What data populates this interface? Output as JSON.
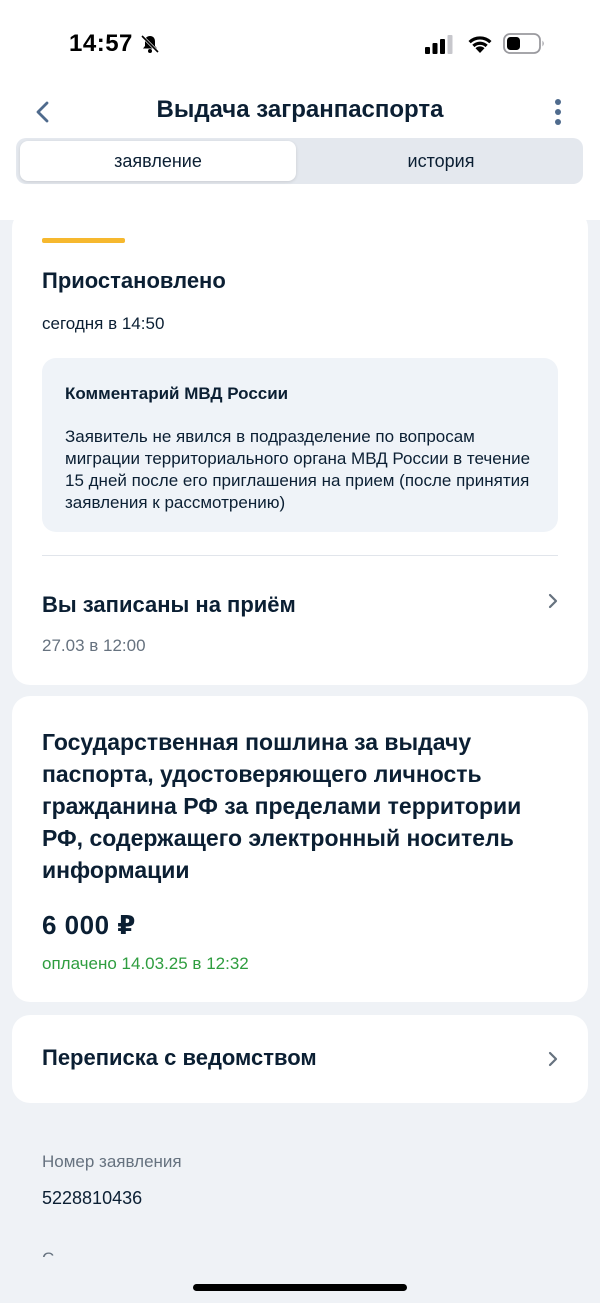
{
  "status_bar": {
    "time": "14:57",
    "icons": [
      "bell-slash-icon",
      "signal-icon",
      "wifi-icon",
      "battery-icon"
    ]
  },
  "header": {
    "title": "Выдача загранпаспорта",
    "back_icon": "chevron-left-icon",
    "menu_icon": "more-vertical-icon"
  },
  "tabs": [
    {
      "label": "заявление",
      "active": true
    },
    {
      "label": "история",
      "active": false
    }
  ],
  "status_card": {
    "accent_color": "#f6b82e",
    "status": "Приостановлено",
    "time": "сегодня в 14:50",
    "comment": {
      "title": "Комментарий МВД России",
      "text": "Заявитель не явился в подразделение по вопросам миграции территориального органа МВД России в течение 15 дней после его приглашения на прием (после принятия заявления к рассмотрению)"
    },
    "appointment": {
      "title": "Вы записаны на приём",
      "date": "27.03 в 12:00"
    }
  },
  "fee_card": {
    "title": "Государственная пошлина за выдачу паспорта, удостоверяющего личность гражданина РФ за пределами территории РФ, содержащего электронный носитель информации",
    "amount": "6 000 ₽",
    "paid": "оплачено 14.03.25 в 12:32",
    "paid_color": "#2e9d3f"
  },
  "correspondence": {
    "title": "Переписка с ведомством"
  },
  "application": {
    "number_label": "Номер заявления",
    "number": "5228810436"
  }
}
